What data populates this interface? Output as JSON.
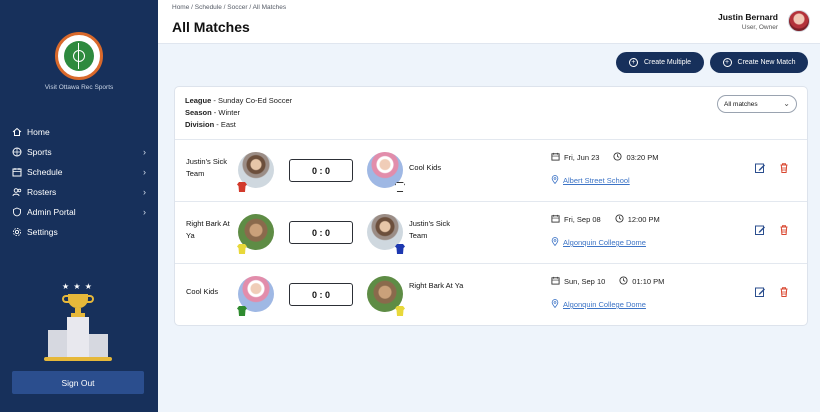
{
  "sidebar": {
    "logo_text": "OTTAWA REC SPORTS",
    "visit_label": "Visit Ottawa Rec Sports",
    "items": [
      {
        "label": "Home",
        "icon": "home-icon",
        "chevron": false
      },
      {
        "label": "Sports",
        "icon": "ball-icon",
        "chevron": true
      },
      {
        "label": "Schedule",
        "icon": "calendar-icon",
        "chevron": true
      },
      {
        "label": "Rosters",
        "icon": "people-icon",
        "chevron": true
      },
      {
        "label": "Admin Portal",
        "icon": "shield-icon",
        "chevron": true
      },
      {
        "label": "Settings",
        "icon": "gear-icon",
        "chevron": false
      }
    ],
    "sign_out": "Sign Out"
  },
  "header": {
    "breadcrumb": "Home / Schedule / Soccer / All Matches",
    "title": "All Matches",
    "user_name": "Justin Bernard",
    "user_role": "User, Owner"
  },
  "actions": {
    "create_multiple": "Create Multiple",
    "create_new": "Create New Match"
  },
  "filters": {
    "league_label": "League",
    "league": "Sunday Co-Ed Soccer",
    "season_label": "Season",
    "season": "Winter",
    "division_label": "Division",
    "division": "East",
    "select_value": "All matches"
  },
  "matches": [
    {
      "home": "Justin's Sick Team",
      "home_shirt": "#d23a2c",
      "away": "Cool Kids",
      "away_shirt": "#ffffff",
      "score": "0 : 0",
      "date": "Fri, Jun 23",
      "time": "03:20 PM",
      "location": "Albert Street School"
    },
    {
      "home": "Right Bark At Ya",
      "home_shirt": "#e8d83a",
      "away": "Justin's Sick Team",
      "away_shirt": "#1d38b0",
      "score": "0 : 0",
      "date": "Fri, Sep 08",
      "time": "12:00 PM",
      "location": "Algonquin College Dome"
    },
    {
      "home": "Cool Kids",
      "home_shirt": "#2f8b2f",
      "away": "Right Bark At Ya",
      "away_shirt": "#e8d83a",
      "score": "0 : 0",
      "date": "Sun, Sep 10",
      "time": "01:10 PM",
      "location": "Algonquin College Dome"
    }
  ],
  "colors": {
    "sidebar_bg": "#17305b",
    "accent": "#17305b",
    "link": "#3d74c6",
    "delete": "#d9462f"
  }
}
